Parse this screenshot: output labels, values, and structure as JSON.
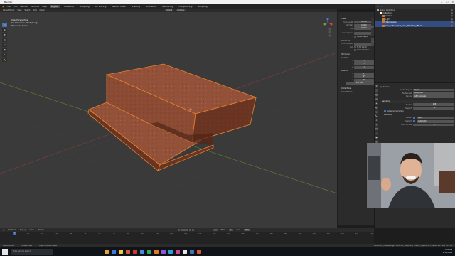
{
  "window": {
    "title": "Blender",
    "controls": [
      "—",
      "☐",
      "✕"
    ]
  },
  "menu": {
    "items": [
      "File",
      "Edit",
      "Render",
      "Window",
      "Help"
    ],
    "workspaces": [
      "Layout",
      "Modeling",
      "Sculpting",
      "UV Editing",
      "Texture Paint",
      "Shading",
      "Animation",
      "Rendering",
      "Compositing",
      "Scripting"
    ],
    "active_workspace": "Layout",
    "scene": "Scene",
    "view_layer": "View Layer"
  },
  "viewport": {
    "header": {
      "mode": "Object Mode",
      "menus": [
        "View",
        "Select",
        "Add",
        "Object"
      ],
      "orientation": "Global",
      "pivot": "Options"
    },
    "info": [
      "User Perspective",
      "(1) Collection | Walls/Ledge",
      "Rendering Done"
    ],
    "tools": [
      "select-box",
      "cursor",
      "move",
      "rotate",
      "scale",
      "transform",
      "annotate",
      "measure"
    ]
  },
  "npanel": {
    "tabs": [
      "Item",
      "Tool",
      "View"
    ],
    "active_tab": "View",
    "view_section": "View",
    "focal_label": "Focal Length",
    "focal_value": "50 mm",
    "clip_start_label": "Clip Start",
    "clip_start_value": "0.01 m",
    "clip_end_label": "End",
    "clip_end_value": "1000 m",
    "local_camera_label": "Local Camera",
    "render_region": "Render Region",
    "view_lock": "View Lock",
    "lock_to_object": "Lock to Object",
    "lock_label": "Lock",
    "to_3d_cursor": "To 3D Cursor",
    "camera_to_view": "Camera to View",
    "cursor_section": "3D Cursor",
    "location_label": "Location:",
    "loc": [
      {
        "axis": "X",
        "val": "0 m"
      },
      {
        "axis": "Y",
        "val": "0 m"
      },
      {
        "axis": "Z",
        "val": "0 m"
      }
    ],
    "rotation_label": "Rotation:",
    "rot": [
      {
        "axis": "X",
        "val": "0°"
      },
      {
        "axis": "Y",
        "val": "0°"
      },
      {
        "axis": "Z",
        "val": "0°"
      }
    ],
    "mode_label": "XYZ Euler",
    "collections": "Collections",
    "annotations": "Annotations"
  },
  "outliner": {
    "header": "Scene Collection",
    "items": [
      {
        "label": "Scene Collection",
        "icon": "#aaaaaa",
        "sel": false,
        "indent": 0
      },
      {
        "label": "Collection",
        "icon": "#ffffff",
        "sel": false,
        "indent": 2
      },
      {
        "label": "Camera",
        "icon": "#c97a3a",
        "sel": false,
        "indent": 4
      },
      {
        "label": "Light",
        "icon": "#c97a3a",
        "sel": false,
        "indent": 4
      },
      {
        "label": "Walls/Ledge",
        "icon": "#c97a3a",
        "sel": true,
        "indent": 4
      },
      {
        "label": "box_surface_tool_brick_Wall Stripy_Block",
        "icon": "#c97a3a",
        "sel": true,
        "indent": 4
      }
    ]
  },
  "properties": {
    "title": "Scene",
    "render_engine_label": "Render Engine",
    "render_engine": "Cycles",
    "feature_set_label": "Feature Set",
    "feature_set": "Supported",
    "device_label": "Device",
    "device": "GPU Compute",
    "sampling": "Sampling",
    "render_label": "Render",
    "render_samples": "128",
    "viewport_label": "Viewport",
    "viewport_samples": "32",
    "adaptive": "Adaptive Sampling",
    "denoising": "Denoising",
    "denoise_render_label": "Render",
    "denoise_render": "OptiX",
    "denoise_viewport_label": "Viewport",
    "denoise_viewport": "Automatic",
    "start_sample_label": "Start Sample",
    "start_sample": "1"
  },
  "timeline": {
    "menus": [
      "Playback",
      "Keying",
      "View",
      "Marker"
    ],
    "start_label": "Start",
    "start": "1",
    "end_label": "End",
    "end": "250",
    "current_frame": "1",
    "ruler": [
      "0",
      "10",
      "20",
      "30",
      "40",
      "50",
      "60",
      "70",
      "80",
      "90",
      "100",
      "110",
      "120",
      "130",
      "140",
      "150",
      "160",
      "170",
      "180",
      "190",
      "200",
      "210",
      "220",
      "230",
      "240",
      "250"
    ]
  },
  "status": {
    "left": "Set 3D Cursor",
    "middle1": "Rotate View",
    "middle2": "Object Context Menu",
    "right": "Collection | Walls/Ledge | Verts:32 | Faces:28 | Tris:56 | Objects:1/3 | Mem: 98.7 MiB | 2.93.1"
  },
  "taskbar": {
    "search": "Type here to search",
    "time": "11:32 PM",
    "date": "9/14/2021",
    "app_colors": [
      "#e6a23c",
      "#3c7bd9",
      "#f2c744",
      "#d8563a",
      "#c93a3a",
      "#4a89dc",
      "#3aa55d",
      "#e67a22",
      "#8c5ad8",
      "#2f9fd8",
      "#c94a8a",
      "#e6e6e6",
      "#4772b3",
      "#d8563a"
    ]
  }
}
